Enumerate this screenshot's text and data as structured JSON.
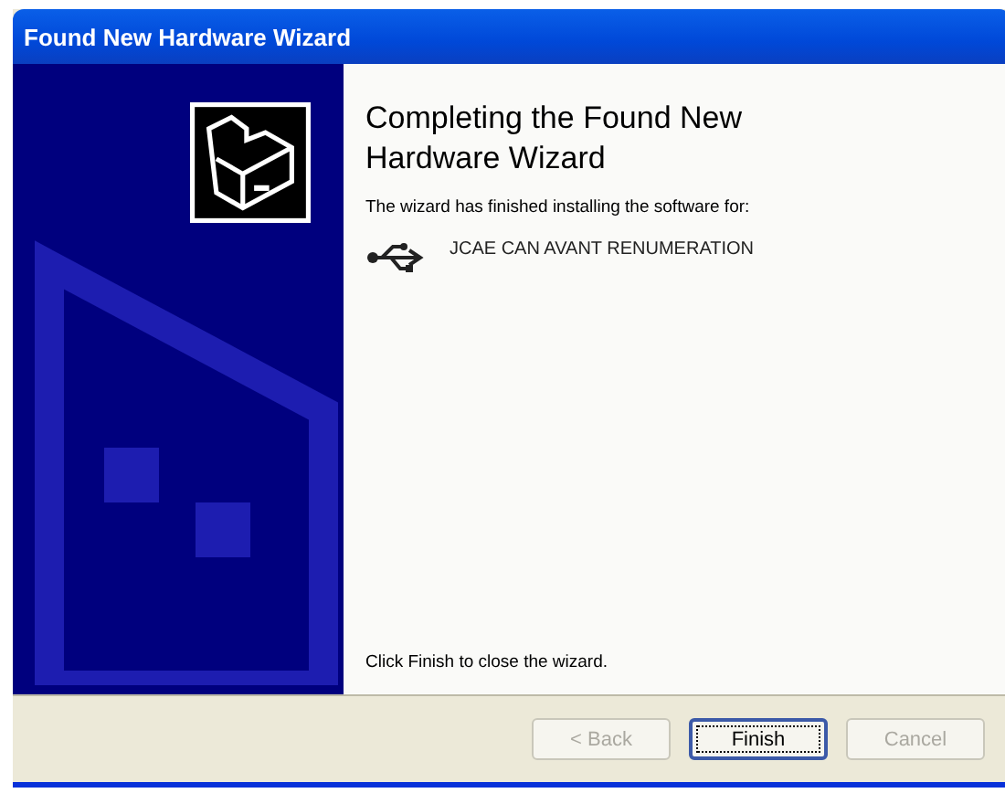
{
  "window": {
    "title": "Found New Hardware Wizard"
  },
  "heading": "Completing the Found New Hardware Wizard",
  "message": "The wizard has finished installing the software for:",
  "device": {
    "name": "JCAE CAN AVANT RENUMERATION"
  },
  "footer": "Click Finish to close the wizard.",
  "buttons": [
    {
      "label": "< Back",
      "disabled": true,
      "default": false
    },
    {
      "label": "Finish",
      "disabled": false,
      "default": true
    },
    {
      "label": "Cancel",
      "disabled": true,
      "default": false
    }
  ]
}
